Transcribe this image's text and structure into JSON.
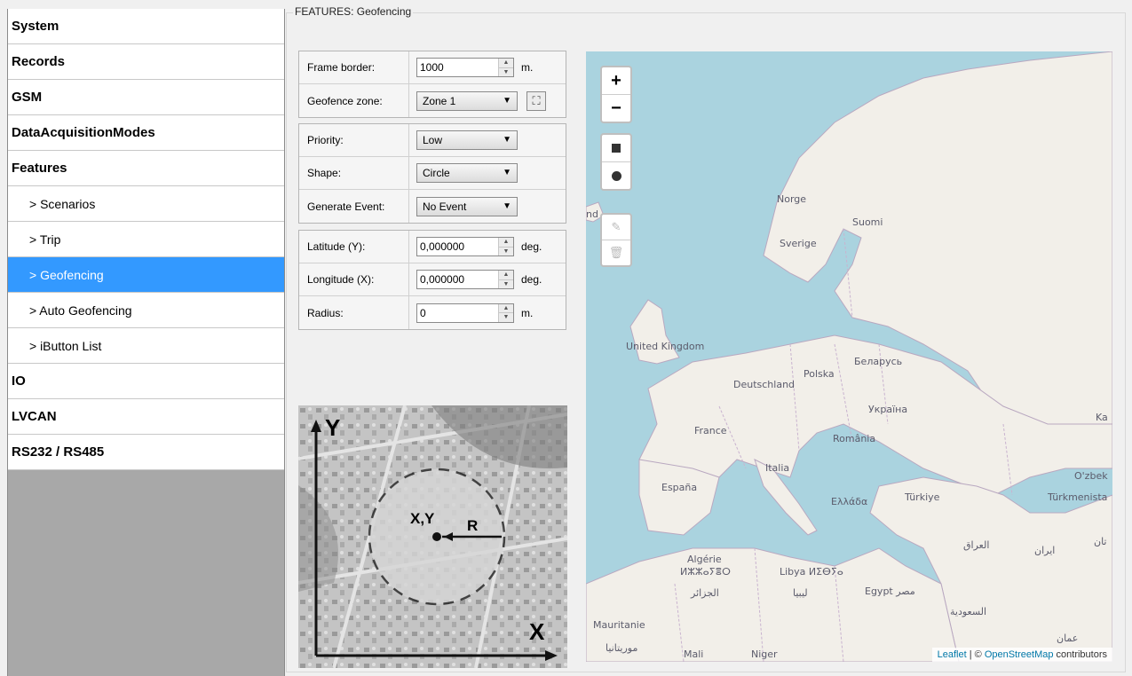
{
  "sidebar": {
    "items": [
      {
        "label": "System"
      },
      {
        "label": "Records"
      },
      {
        "label": "GSM"
      },
      {
        "label": "DataAcquisitionModes"
      },
      {
        "label": "Features"
      },
      {
        "label": "> Scenarios"
      },
      {
        "label": "> Trip"
      },
      {
        "label": "> Geofencing"
      },
      {
        "label": "> Auto Geofencing"
      },
      {
        "label": "> iButton List"
      },
      {
        "label": "IO"
      },
      {
        "label": "LVCAN"
      },
      {
        "label": "RS232 / RS485"
      }
    ]
  },
  "group": {
    "title": "FEATURES: Geofencing"
  },
  "form": {
    "frame_border": {
      "label": "Frame border:",
      "value": "1000",
      "unit": "m."
    },
    "geofence_zone": {
      "label": "Geofence zone:",
      "value": "Zone 1"
    },
    "priority": {
      "label": "Priority:",
      "value": "Low"
    },
    "shape": {
      "label": "Shape:",
      "value": "Circle"
    },
    "generate_event": {
      "label": "Generate Event:",
      "value": "No Event"
    },
    "latitude": {
      "label": "Latitude (Y):",
      "value": "0,000000",
      "unit": "deg."
    },
    "longitude": {
      "label": "Longitude (X):",
      "value": "0,000000",
      "unit": "deg."
    },
    "radius": {
      "label": "Radius:",
      "value": "0",
      "unit": "m."
    }
  },
  "illustration": {
    "y_label": "Y",
    "x_label": "X",
    "center_label": "X,Y",
    "radius_label": "R"
  },
  "map": {
    "zoom_in": "+",
    "zoom_out": "−",
    "labels": {
      "norge": "Norge",
      "suomi": "Suomi",
      "sverige": "Sverige",
      "uk": "United Kingdom",
      "belarus": "Беларусь",
      "polska": "Polska",
      "deutschland": "Deutschland",
      "ukraina": "Україна",
      "france": "France",
      "romania": "România",
      "italia": "Italia",
      "espana": "España",
      "turkiye": "Türkiye",
      "ellada": "Ελλάδα",
      "uzbek": "O'zbek",
      "turkmen": "Türkmenista",
      "ka": "Ka",
      "iraq": "العراق",
      "iran": "ایران",
      "stan": "تان",
      "algerie": "Algérie",
      "tifinagh": "ⵍⵣⵣⴰⵢⴻⵔ",
      "jazair": "الجزائر",
      "libya": "Libya ⵍⵉⴱⵢⴰ",
      "libya_ar": "ليبيا",
      "egypt": "Egypt مصر",
      "saudi": "السعودية",
      "mauritanie": "Mauritanie",
      "mauritania_ar": "موريتانيا",
      "mali": "Mali",
      "niger": "Niger",
      "oman": "عمان",
      "nd": "nd"
    },
    "attribution": {
      "leaflet": "Leaflet",
      "sep": " | © ",
      "osm": "OpenStreetMap",
      "contrib": " contributors"
    }
  }
}
